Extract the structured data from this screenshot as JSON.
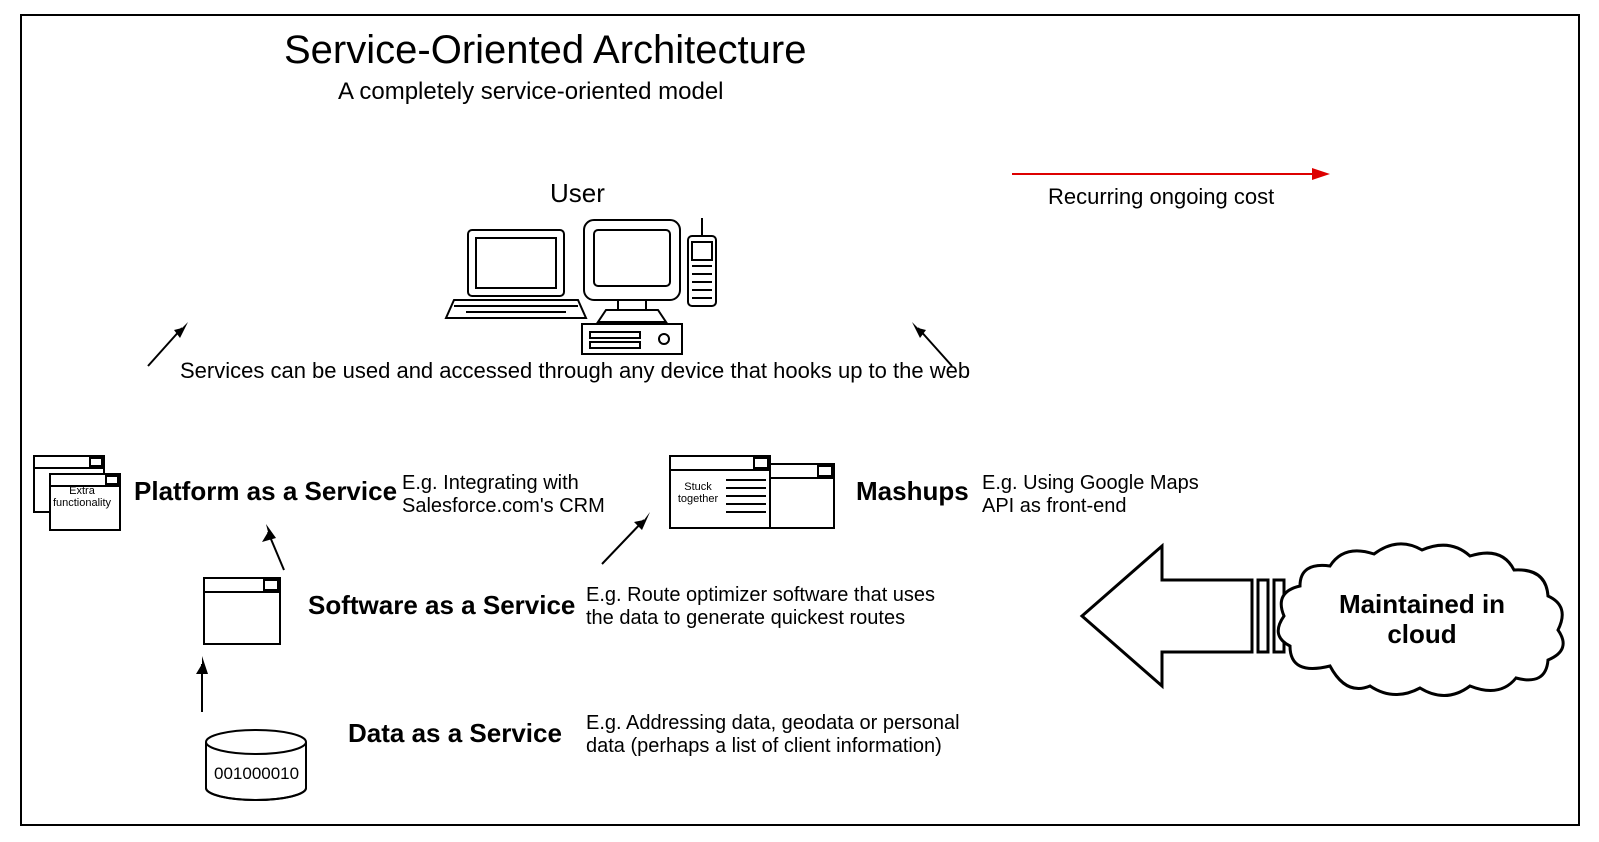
{
  "title": "Service-Oriented Architecture",
  "subtitle": "A completely service-oriented model",
  "user_label": "User",
  "user_caption": "Services can be used and accessed through any device that hooks up to the web",
  "recurring_cost": "Recurring ongoing cost",
  "paas": {
    "icon_text": "Extra functionality",
    "label": "Platform as a Service",
    "example": "E.g. Integrating with Salesforce.com's CRM"
  },
  "mashups": {
    "icon_text": "Stuck together",
    "label": "Mashups",
    "example": "E.g. Using Google Maps API as front-end"
  },
  "saas": {
    "label": "Software as a Service",
    "example": "E.g. Route optimizer software that uses the data to generate quickest routes"
  },
  "daas": {
    "label": "Data as a Service",
    "example": "E.g. Addressing data, geodata or personal data (perhaps a list of client information)",
    "db_text": "001000010"
  },
  "cloud_label": "Maintained in cloud"
}
